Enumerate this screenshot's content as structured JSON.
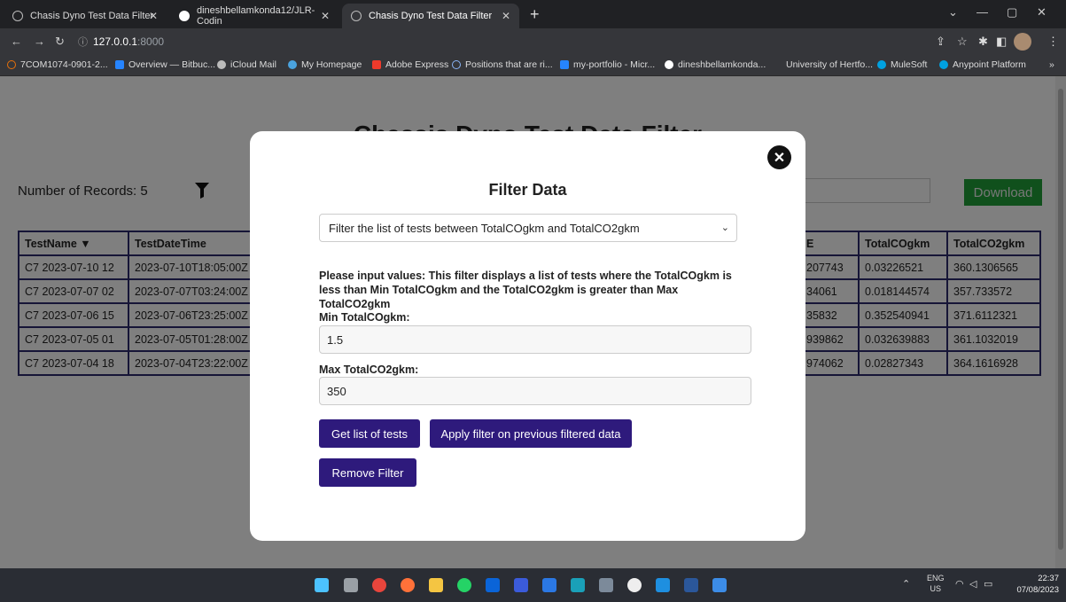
{
  "browser": {
    "tabs": [
      {
        "title": "Chasis Dyno Test Data Filter",
        "active": false
      },
      {
        "title": "dineshbellamkonda12/JLR-Codin",
        "active": false
      },
      {
        "title": "Chasis Dyno Test Data Filter",
        "active": true
      }
    ],
    "address": {
      "host": "127.0.0.1",
      "port": ":8000"
    },
    "bookmarks": [
      "7COM1074-0901-2...",
      "Overview — Bitbuc...",
      "iCloud Mail",
      "My Homepage",
      "Adobe Express",
      "Positions that are ri...",
      "my-portfolio - Micr...",
      "dineshbellamkonda...",
      "University of Hertfo...",
      "MuleSoft",
      "Anypoint Platform"
    ]
  },
  "page": {
    "title": "Chassis Dyno Test Data Filter",
    "record_count": "Number of Records: 5",
    "download_label": "Download",
    "table_left": {
      "headers": [
        "TestName ▼",
        "TestDateTime"
      ],
      "rows": [
        [
          "C7 2023-07-10 12",
          "2023-07-10T18:05:00Z"
        ],
        [
          "C7 2023-07-07 02",
          "2023-07-07T03:24:00Z"
        ],
        [
          "C7 2023-07-06 15",
          "2023-07-06T23:25:00Z"
        ],
        [
          "C7 2023-07-05 01",
          "2023-07-05T01:28:00Z"
        ],
        [
          "C7 2023-07-04 18",
          "2023-07-04T23:22:00Z"
        ]
      ]
    },
    "table_right": {
      "headers": [
        "E",
        "TotalCOgkm",
        "TotalCO2gkm"
      ],
      "rows": [
        [
          "207743",
          "0.03226521",
          "360.1306565"
        ],
        [
          "34061",
          "0.018144574",
          "357.733572"
        ],
        [
          "35832",
          "0.352540941",
          "371.6112321"
        ],
        [
          "939862",
          "0.032639883",
          "361.1032019"
        ],
        [
          "974062",
          "0.02827343",
          "364.1616928"
        ]
      ]
    }
  },
  "modal": {
    "title": "Filter Data",
    "select_value": "Filter the list of tests between TotalCOgkm and TotalCO2gkm",
    "instructions": "Please input values: This filter displays a list of tests where the TotalCOgkm is less than Min TotalCOgkm and the TotalCO2gkm is greater than Max TotalCO2gkm",
    "min_label": "Min TotalCOgkm:",
    "min_value": "1.5",
    "max_label": "Max TotalCO2gkm:",
    "max_value": "350",
    "get_list_label": "Get list of tests",
    "apply_prev_label": "Apply filter on previous filtered data",
    "remove_label": "Remove Filter"
  },
  "taskbar": {
    "lang": "ENG",
    "region": "US",
    "time": "22:37",
    "date": "07/08/2023"
  }
}
